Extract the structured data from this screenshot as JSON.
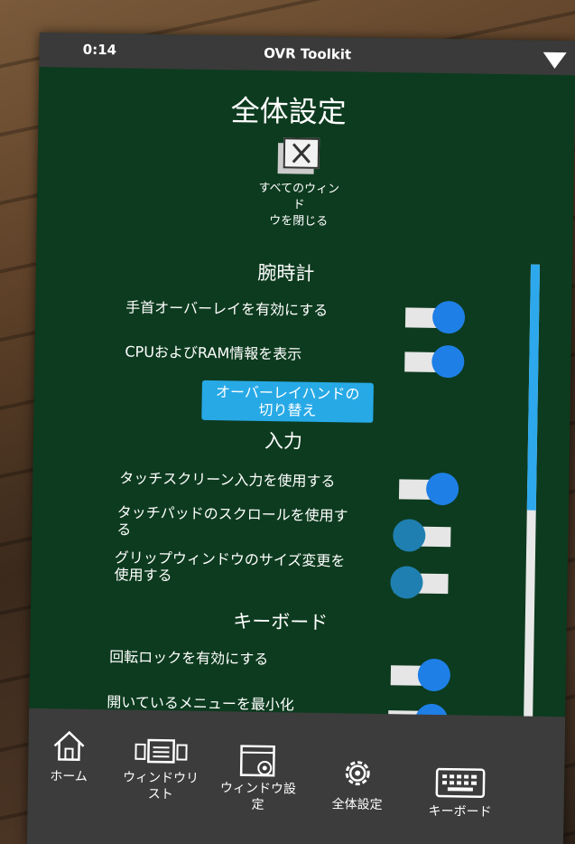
{
  "window": {
    "clock": "0:14",
    "title": "OVR Toolkit"
  },
  "page": {
    "heading": "全体設定"
  },
  "close_all": {
    "label_line1": "すべてのウィンド",
    "label_line2": "ウを閉じる"
  },
  "sections": {
    "watch": "腕時計",
    "input": "入力",
    "keyboard": "キーボード"
  },
  "settings": {
    "wrist_overlay": {
      "label": "手首オーバーレイを有効にする",
      "enabled": true
    },
    "cpu_ram": {
      "label": "CPUおよびRAM情報を表示",
      "enabled": true
    },
    "touchscreen": {
      "label": "タッチスクリーン入力を使用する",
      "enabled": true
    },
    "touchpad_scroll": {
      "label_line1": "タッチパッドのスクロールを使用す",
      "label_line2": "る",
      "enabled": false
    },
    "grip_resize": {
      "label_line1": "グリップウィンドウのサイズ変更を",
      "label_line2": "使用する",
      "enabled": false
    },
    "rotation_lock": {
      "label": "回転ロックを有効にする",
      "enabled": true
    },
    "minimize_menu": {
      "label": "開いているメニューを最小化",
      "enabled": true
    }
  },
  "overlay_hand_button": {
    "line1": "オーバーレイハンドの",
    "line2": "切り替え"
  },
  "nav": {
    "home": "ホーム",
    "window_list_line1": "ウィンドウリ",
    "window_list_line2": "スト",
    "window_settings_line1": "ウィンドウ設",
    "window_settings_line2": "定",
    "global_settings": "全体設定",
    "keyboard": "キーボード"
  },
  "colors": {
    "panel": "#0d3b1f",
    "accent": "#27a9e6",
    "toggle_on": "#1e7fe6",
    "bars": "#3a3a3a"
  }
}
